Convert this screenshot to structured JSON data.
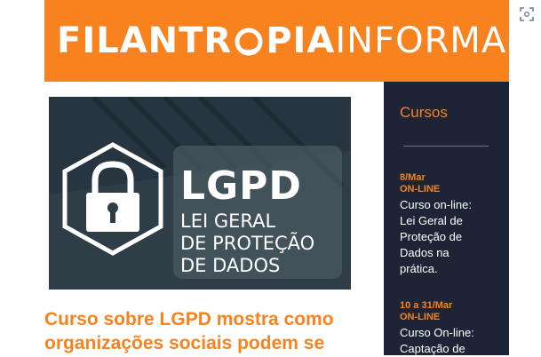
{
  "brand": {
    "name_bold_1": "FILANTR",
    "name_bold_2": "PIA",
    "name_light": "INFORMA"
  },
  "colors": {
    "accent": "#f7821e",
    "sidebar_bg": "#1d2436",
    "hero_bg": "#2e3d46",
    "text_white": "#ffffff"
  },
  "hero": {
    "title": "LGPD",
    "subtitle_lines": [
      "LEI GERAL",
      "DE PROTEÇÃO",
      "DE DADOS"
    ],
    "icon": "padlock-hexagon-icon"
  },
  "article": {
    "headline_lines": [
      "Curso sobre LGPD mostra como",
      "organizações sociais podem se"
    ]
  },
  "sidebar": {
    "title": "Cursos",
    "events": [
      {
        "date": "8/Mar",
        "mode": "ON-LINE",
        "title_lines": [
          "Curso on-line:",
          "Lei Geral de",
          "Proteção de",
          "Dados na",
          "prática."
        ]
      },
      {
        "date": "10 a 31/Mar",
        "mode": "ON-LINE",
        "title_lines": [
          "Curso On-line:",
          "Captação de"
        ]
      }
    ]
  },
  "screen_icon": "screenshot-capture-icon"
}
